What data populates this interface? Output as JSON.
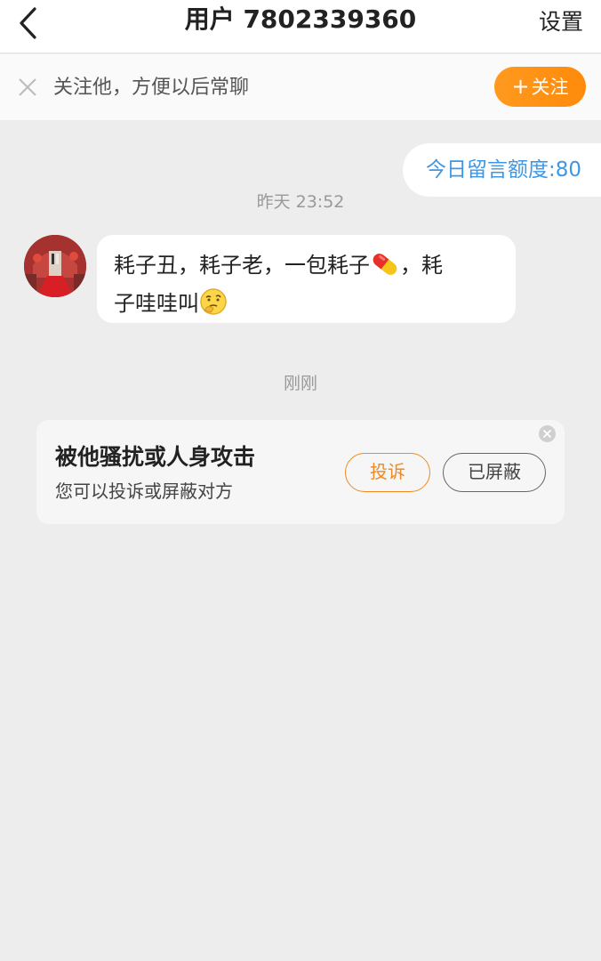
{
  "header": {
    "title": "用户 7802339360",
    "settings_label": "设置",
    "back_icon": "chevron-left-icon"
  },
  "follow_bar": {
    "text": "关注他，方便以后常聊",
    "button_label": "关注",
    "button_icon": "plus-icon",
    "close_icon": "close-icon",
    "accent_color": "#ff9a1f"
  },
  "quota": {
    "text": "今日留言额度:80",
    "color": "#3d97e6"
  },
  "messages": [
    {
      "timestamp": "昨天 23:52",
      "text_part1": "耗子丑，耗子老，一包耗子",
      "text_part2": "，耗",
      "text_part3": "子哇哇叫",
      "emojis": [
        "pill-emoji",
        "thinking-face-emoji"
      ]
    }
  ],
  "system": {
    "timestamp": "刚刚",
    "card_title": "被他骚扰或人身攻击",
    "card_subtitle": "您可以投诉或屏蔽对方",
    "complain_label": "投诉",
    "block_label": "已屏蔽",
    "complain_color": "#f08a20"
  }
}
